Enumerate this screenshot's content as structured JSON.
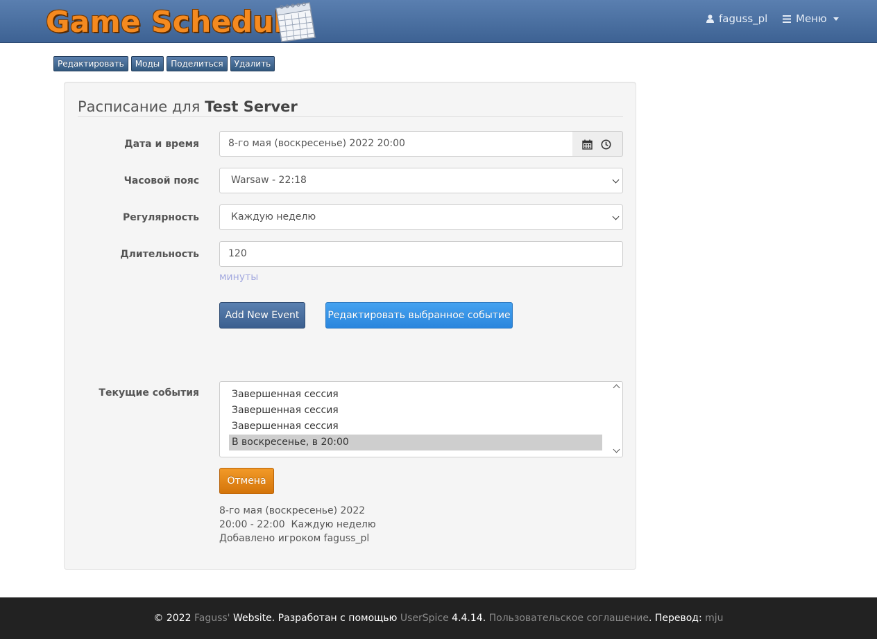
{
  "navbar": {
    "logo_text": "Game Schedule",
    "user_label": "faguss_pl",
    "menu_label": "Меню"
  },
  "toolbar": {
    "edit": "Редактировать",
    "mods": "Моды",
    "share": "Поделиться",
    "delete": "Удалить"
  },
  "form": {
    "title_prefix": "Расписание для",
    "title_server": "Test Server",
    "datetime": {
      "label": "Дата и время",
      "value": "8-го мая (воскресенье) 2022 20:00"
    },
    "timezone": {
      "label": "Часовой пояс",
      "value": "Warsaw - 22:18"
    },
    "recurrence": {
      "label": "Регулярность",
      "value": "Каждую неделю"
    },
    "duration": {
      "label": "Длительность",
      "value": "120",
      "help": "минуты"
    },
    "add_button": "Add New Event",
    "edit_selected_button": "Редактировать выбранное событие",
    "events": {
      "label": "Текущие события",
      "items": [
        "Завершенная сессия",
        "Завершенная сессия",
        "Завершенная сессия",
        "В воскресенье, в 20:00"
      ],
      "selected_index": 3
    },
    "cancel_button": "Отмена",
    "details": {
      "date": "8-го мая (воскресенье) 2022",
      "time_recurrence": "20:00 - 22:00  Каждую неделю",
      "added_by": "Добавлено игроком faguss_pl"
    }
  },
  "footer": {
    "copyright": "© 2022",
    "faguss_link": "Faguss'",
    "website_text": "Website. Разработан с помощью",
    "userspice_link": "UserSpice",
    "version": "4.4.14.",
    "agreement_link": "Пользовательское соглашение",
    "translation_text": ". Перевод:",
    "translator_link": "mju"
  },
  "colors": {
    "navbar": "#4a6fa0",
    "logo_orange": "#f58a1f",
    "primary": "#3b5f8f",
    "info": "#2a86dd",
    "warning": "#e58a1a",
    "footer": "#222222"
  }
}
